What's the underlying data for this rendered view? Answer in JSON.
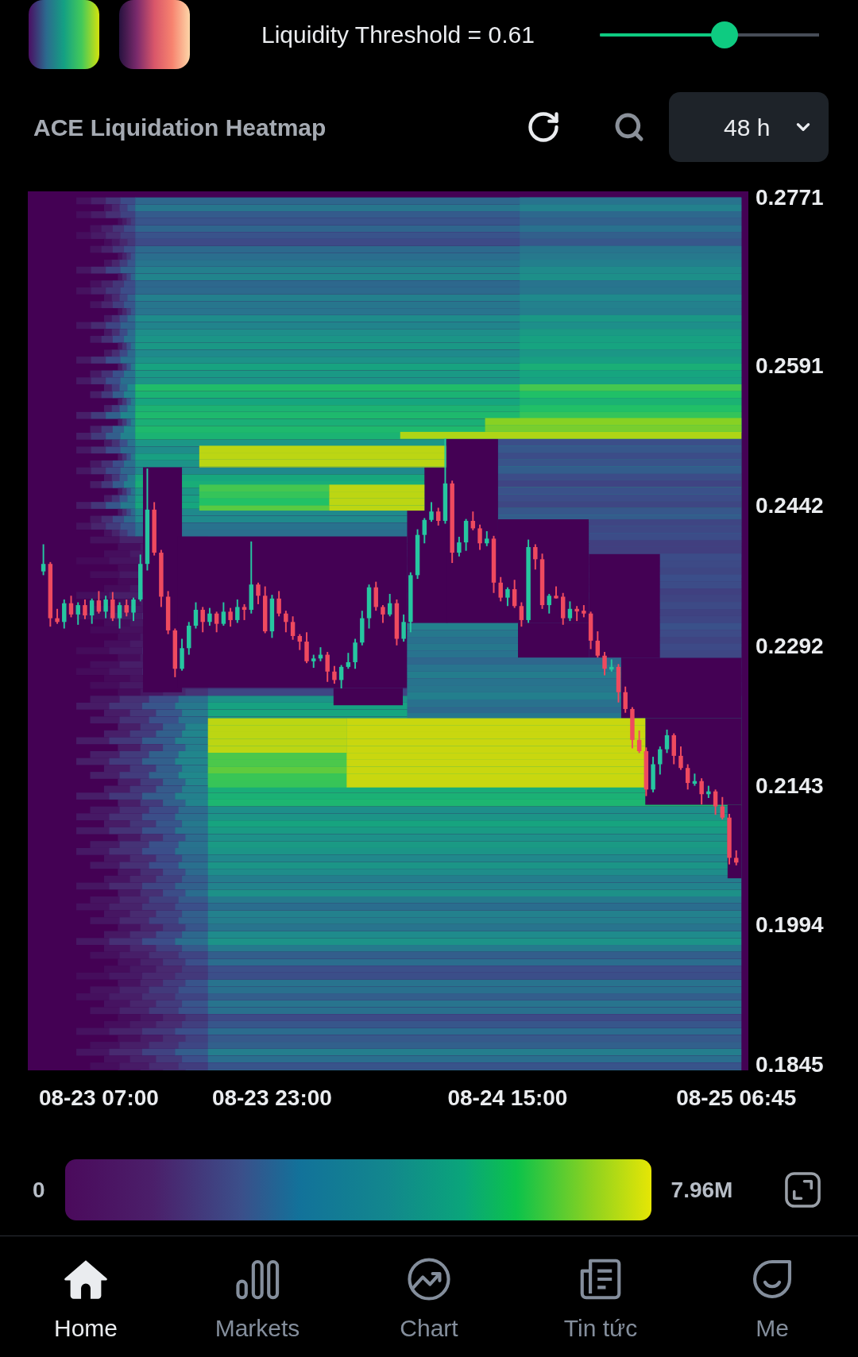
{
  "threshold": {
    "label": "Liquidity Threshold = 0.61",
    "level": 0.57
  },
  "header": {
    "title": "ACE Liquidation Heatmap",
    "timeframe": "48 h"
  },
  "heatmap": {
    "chart_data": {
      "type": "candlestick",
      "ylim": [
        0.1839,
        0.2778
      ],
      "yticks": [
        0.2771,
        0.2591,
        0.2442,
        0.2292,
        0.2143,
        0.1994,
        0.1845
      ],
      "categories": [
        null,
        null,
        null,
        null,
        null,
        null,
        null,
        null,
        "08-23 07:00",
        null,
        null,
        null,
        null,
        null,
        null,
        null,
        null,
        null,
        null,
        null,
        null,
        null,
        null,
        null,
        null,
        null,
        null,
        null,
        null,
        null,
        null,
        null,
        null,
        "08-23 23:00",
        null,
        null,
        null,
        null,
        null,
        null,
        null,
        null,
        null,
        null,
        null,
        null,
        null,
        null,
        null,
        null,
        null,
        null,
        null,
        null,
        null,
        null,
        null,
        null,
        null,
        null,
        null,
        null,
        null,
        null,
        null,
        null,
        null,
        "08-24 15:00",
        null,
        null,
        null,
        null,
        null,
        null,
        null,
        null,
        null,
        null,
        null,
        null,
        null,
        null,
        null,
        null,
        null,
        null,
        null,
        null,
        null,
        null,
        null,
        null,
        null,
        null,
        null,
        null,
        null,
        null,
        null,
        null,
        "08-25 06:45"
      ],
      "ohlc": [
        [
          0.2372,
          0.2401,
          0.2368,
          0.238
        ],
        [
          0.238,
          0.2382,
          0.2313,
          0.2322
        ],
        [
          0.2322,
          0.2332,
          0.2316,
          0.2318
        ],
        [
          0.2318,
          0.2342,
          0.2311,
          0.2338
        ],
        [
          0.2338,
          0.2346,
          0.2323,
          0.2326
        ],
        [
          0.2326,
          0.2339,
          0.2315,
          0.2336
        ],
        [
          0.2336,
          0.2342,
          0.2321,
          0.2325
        ],
        [
          0.2325,
          0.2343,
          0.2316,
          0.2341
        ],
        [
          0.2341,
          0.2351,
          0.2327,
          0.2329
        ],
        [
          0.2329,
          0.2346,
          0.2322,
          0.2342
        ],
        [
          0.2342,
          0.235,
          0.2319,
          0.2322
        ],
        [
          0.2322,
          0.2339,
          0.2311,
          0.2336
        ],
        [
          0.2336,
          0.2342,
          0.2324,
          0.2328
        ],
        [
          0.2328,
          0.2344,
          0.2319,
          0.2342
        ],
        [
          0.2342,
          0.239,
          0.234,
          0.238
        ],
        [
          0.238,
          0.2482,
          0.2373,
          0.2438
        ],
        [
          0.2438,
          0.2446,
          0.2389,
          0.2392
        ],
        [
          0.2392,
          0.2395,
          0.2334,
          0.2345
        ],
        [
          0.2345,
          0.2351,
          0.2305,
          0.2309
        ],
        [
          0.2309,
          0.2311,
          0.2259,
          0.2268
        ],
        [
          0.2268,
          0.23,
          0.2266,
          0.229
        ],
        [
          0.229,
          0.2318,
          0.2283,
          0.2314
        ],
        [
          0.2314,
          0.2339,
          0.2311,
          0.2331
        ],
        [
          0.2331,
          0.2334,
          0.2307,
          0.2318
        ],
        [
          0.2318,
          0.2333,
          0.2314,
          0.2327
        ],
        [
          0.2327,
          0.2329,
          0.2307,
          0.2316
        ],
        [
          0.2316,
          0.2339,
          0.2314,
          0.2329
        ],
        [
          0.2329,
          0.2333,
          0.2313,
          0.232
        ],
        [
          0.232,
          0.2342,
          0.2317,
          0.2334
        ],
        [
          0.2334,
          0.2337,
          0.232,
          0.2331
        ],
        [
          0.2331,
          0.2404,
          0.2327,
          0.2358
        ],
        [
          0.2358,
          0.236,
          0.2337,
          0.2346
        ],
        [
          0.2346,
          0.2356,
          0.2306,
          0.2308
        ],
        [
          0.2308,
          0.2347,
          0.2301,
          0.2343
        ],
        [
          0.2343,
          0.2351,
          0.2324,
          0.2327
        ],
        [
          0.2327,
          0.233,
          0.2307,
          0.2318
        ],
        [
          0.2318,
          0.2324,
          0.2299,
          0.2303
        ],
        [
          0.2303,
          0.2305,
          0.2288,
          0.2297
        ],
        [
          0.2297,
          0.2307,
          0.2274,
          0.2276
        ],
        [
          0.2276,
          0.2283,
          0.2269,
          0.2279
        ],
        [
          0.2279,
          0.2291,
          0.2276,
          0.2283
        ],
        [
          0.2283,
          0.2286,
          0.2254,
          0.2265
        ],
        [
          0.2265,
          0.2271,
          0.2252,
          0.2256
        ],
        [
          0.2256,
          0.2272,
          0.2247,
          0.227
        ],
        [
          0.227,
          0.2285,
          0.2268,
          0.2275
        ],
        [
          0.2275,
          0.23,
          0.2268,
          0.2296
        ],
        [
          0.2296,
          0.233,
          0.2293,
          0.2322
        ],
        [
          0.2322,
          0.2358,
          0.2311,
          0.2355
        ],
        [
          0.2355,
          0.2361,
          0.233,
          0.2334
        ],
        [
          0.2334,
          0.2336,
          0.2317,
          0.2326
        ],
        [
          0.2326,
          0.2348,
          0.2324,
          0.2338
        ],
        [
          0.2338,
          0.2342,
          0.2293,
          0.23
        ],
        [
          0.23,
          0.2326,
          0.2297,
          0.2318
        ],
        [
          0.2318,
          0.2371,
          0.2307,
          0.2368
        ],
        [
          0.2368,
          0.2417,
          0.2364,
          0.2411
        ],
        [
          0.2411,
          0.2429,
          0.2402,
          0.2427
        ],
        [
          0.2427,
          0.2446,
          0.2425,
          0.2436
        ],
        [
          0.2436,
          0.244,
          0.2421,
          0.2426
        ],
        [
          0.2426,
          0.2514,
          0.2423,
          0.2466
        ],
        [
          0.2466,
          0.2469,
          0.2381,
          0.2392
        ],
        [
          0.2392,
          0.2409,
          0.2388,
          0.2403
        ],
        [
          0.2403,
          0.2428,
          0.2394,
          0.2426
        ],
        [
          0.2426,
          0.2436,
          0.2416,
          0.2418
        ],
        [
          0.2418,
          0.2422,
          0.2395,
          0.2402
        ],
        [
          0.2402,
          0.2415,
          0.2399,
          0.2407
        ],
        [
          0.2407,
          0.241,
          0.2349,
          0.236
        ],
        [
          0.236,
          0.2366,
          0.234,
          0.2344
        ],
        [
          0.2344,
          0.2355,
          0.2335,
          0.2353
        ],
        [
          0.2353,
          0.2363,
          0.2333,
          0.2335
        ],
        [
          0.2335,
          0.2339,
          0.2313,
          0.232
        ],
        [
          0.232,
          0.2406,
          0.2317,
          0.2398
        ],
        [
          0.2398,
          0.2401,
          0.2374,
          0.2385
        ],
        [
          0.2385,
          0.2391,
          0.2332,
          0.2336
        ],
        [
          0.2336,
          0.2348,
          0.2327,
          0.2346
        ],
        [
          0.2346,
          0.2356,
          0.2343,
          0.2345
        ],
        [
          0.2345,
          0.2349,
          0.2315,
          0.2322
        ],
        [
          0.2322,
          0.234,
          0.2319,
          0.2332
        ],
        [
          0.2332,
          0.2335,
          0.2319,
          0.233
        ],
        [
          0.233,
          0.2336,
          0.2323,
          0.2327
        ],
        [
          0.2327,
          0.2329,
          0.2289,
          0.2298
        ],
        [
          0.2298,
          0.2308,
          0.228,
          0.2282
        ],
        [
          0.2282,
          0.2286,
          0.2261,
          0.2268
        ],
        [
          0.2268,
          0.2278,
          0.2265,
          0.227
        ],
        [
          0.227,
          0.2273,
          0.2232,
          0.2243
        ],
        [
          0.2243,
          0.2249,
          0.2221,
          0.2225
        ],
        [
          0.2225,
          0.2227,
          0.2183,
          0.2192
        ],
        [
          0.2192,
          0.2202,
          0.2178,
          0.218
        ],
        [
          0.218,
          0.2184,
          0.2132,
          0.2139
        ],
        [
          0.2139,
          0.2174,
          0.2136,
          0.2166
        ],
        [
          0.2166,
          0.2185,
          0.2155,
          0.2182
        ],
        [
          0.2182,
          0.2203,
          0.2178,
          0.2197
        ],
        [
          0.2197,
          0.2199,
          0.2166,
          0.2175
        ],
        [
          0.2175,
          0.2185,
          0.216,
          0.2162
        ],
        [
          0.2162,
          0.2166,
          0.2139,
          0.2146
        ],
        [
          0.2146,
          0.2156,
          0.2143,
          0.2148
        ],
        [
          0.2148,
          0.2151,
          0.2123,
          0.2134
        ],
        [
          0.2134,
          0.2143,
          0.213,
          0.2137
        ],
        [
          0.2137,
          0.2139,
          0.2112,
          0.2121
        ],
        [
          0.2121,
          0.2131,
          0.2107,
          0.2109
        ],
        [
          0.2109,
          0.2113,
          0.2059,
          0.2066
        ],
        [
          0.2066,
          0.2074,
          0.2058,
          0.2061
        ]
      ]
    }
  },
  "legend": {
    "min": "0",
    "max": "7.96M"
  },
  "nav": [
    {
      "label": "Home",
      "selected": true
    },
    {
      "label": "Markets",
      "selected": false
    },
    {
      "label": "Chart",
      "selected": false
    },
    {
      "label": "Tin tức",
      "selected": false
    },
    {
      "label": "Me",
      "selected": false
    }
  ]
}
